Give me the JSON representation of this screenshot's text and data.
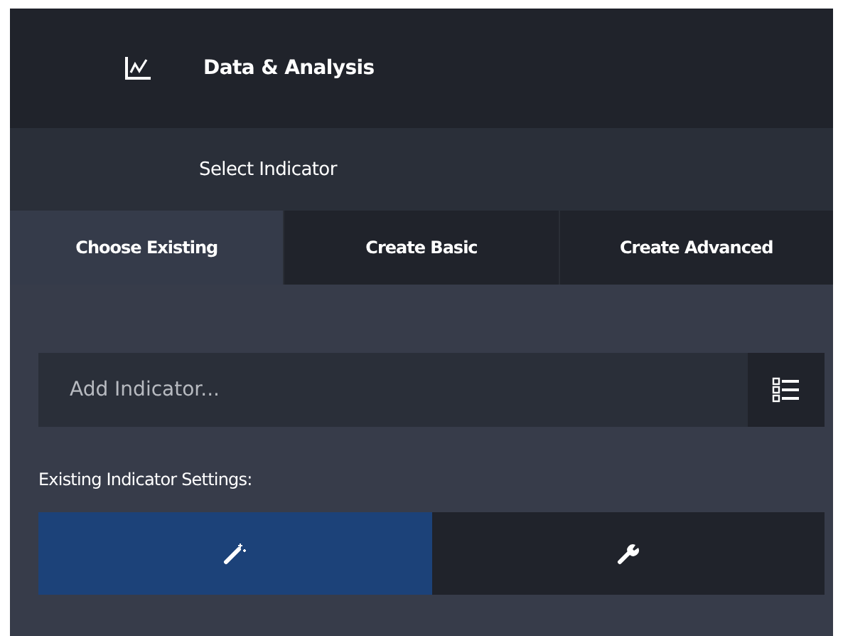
{
  "header": {
    "title": "Data & Analysis"
  },
  "section": {
    "title": "Select Indicator"
  },
  "tabs": [
    {
      "label": "Choose Existing",
      "selected": true
    },
    {
      "label": "Create Basic",
      "selected": false
    },
    {
      "label": "Create Advanced",
      "selected": false
    }
  ],
  "search": {
    "placeholder": "Add Indicator..."
  },
  "settings_label": "Existing Indicator Settings:",
  "setting_buttons": [
    {
      "kind": "wand",
      "selected": true
    },
    {
      "kind": "wrench",
      "selected": false
    }
  ]
}
